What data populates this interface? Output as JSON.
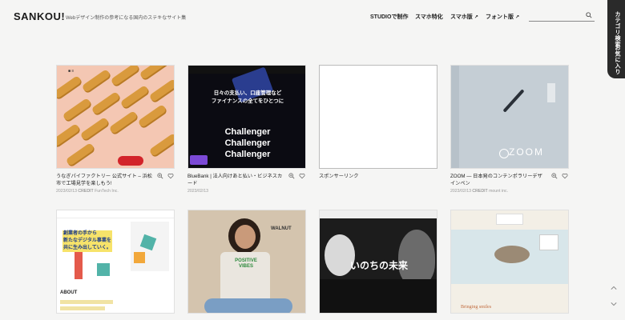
{
  "header": {
    "logo": "SANKOU!",
    "tagline": "Webデザイン制作の参考になる国内のステキなサイト集",
    "nav": [
      {
        "label": "STUDIOで制作"
      },
      {
        "label": "スマホ特化"
      },
      {
        "label": "スマホ版",
        "ext": "↗"
      },
      {
        "label": "フォント版",
        "ext": "↗"
      }
    ],
    "search": {
      "value": "",
      "placeholder": ""
    }
  },
  "sidetab": {
    "category": "カテゴリ検索",
    "favorites": "お気に入り"
  },
  "cards": [
    {
      "title": "うなぎパイファクトリー 公式サイト – 浜松市で工場見学を楽しもう!",
      "date": "2023/02/13",
      "credit_label": "CREDIT",
      "credit": "FunTech Inc."
    },
    {
      "title": "BlueBank | 法人向けあと払い・ビジネスカード",
      "date": "2023/02/13",
      "credit_label": "",
      "credit": ""
    },
    {
      "title": "スポンサーリンク",
      "date": "",
      "credit_label": "",
      "credit": ""
    },
    {
      "title": "ZOOM — 日本発のコンテンポラリーデザインペン",
      "date": "2023/02/13",
      "credit_label": "CREDIT",
      "credit": "mount inc."
    },
    {
      "title": "",
      "date": "",
      "credit_label": "",
      "credit": ""
    },
    {
      "title": "",
      "date": "",
      "credit_label": "",
      "credit": ""
    },
    {
      "title": "",
      "date": "",
      "credit_label": "",
      "credit": ""
    },
    {
      "title": "",
      "date": "",
      "credit_label": "",
      "credit": ""
    }
  ],
  "thumbs": {
    "bluebank_lines": [
      "日々の支払い、口座管理など",
      "ファイナンスの全てをひとつに",
      "Challenger",
      "Challenger",
      "Challenger"
    ],
    "zoom_word": "ZOOM",
    "anniv_lines": [
      "創業者の手から",
      "新たなデジタル事業を",
      "共に生み出していく。"
    ],
    "about_label": "ABOUT",
    "positive_text": "POSITIVE VIBES",
    "walnut_text": "WALNUT",
    "inochi_title": "いのちの未来",
    "bringing_text": "Bringing smiles"
  },
  "colors": {
    "accent_red": "#d2242a",
    "dark_tab": "#2a2a2a"
  }
}
